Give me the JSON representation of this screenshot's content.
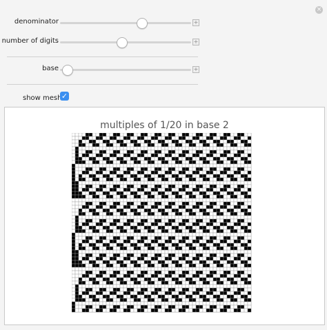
{
  "controls": [
    {
      "id": "denominator",
      "label": "denominator",
      "value_fraction": 0.62
    },
    {
      "id": "digits",
      "label": "number of digits",
      "value_fraction": 0.47
    },
    {
      "id": "base",
      "label": "base",
      "value_fraction": 0.05
    }
  ],
  "show_mesh": {
    "label": "show mesh",
    "checked": true
  },
  "plot": {
    "title": "multiples of 1/20 in base 2"
  },
  "chart_data": {
    "type": "heatmap",
    "title": "multiples of 1/20 in base 2",
    "denominator": 20,
    "base": 2,
    "rows": 52,
    "digits": 52,
    "colors": {
      "one": "#000000",
      "zero": "#ffffff",
      "mesh": "#999999"
    }
  }
}
